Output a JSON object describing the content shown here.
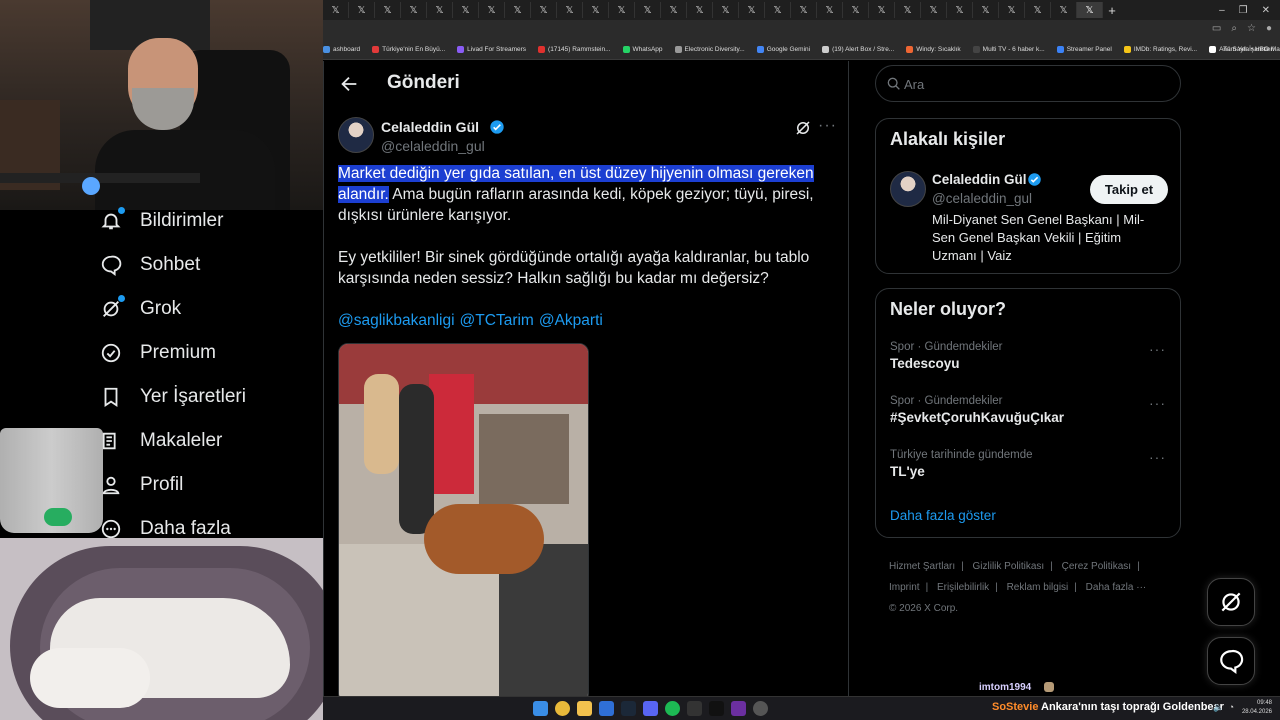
{
  "browser": {
    "tab_glyph": "𝕏",
    "tab_count": 30,
    "new_tab": "+",
    "bookmarks": [
      "ashboard",
      "Türkiye'nin En Büyü...",
      "Livad For Streamers",
      "(17145) Rammstein...",
      "WhatsApp",
      "Electronic Diversity...",
      "Google Gemini",
      "(19) Alert Box / Stre...",
      "Windy: Sıcaklık",
      "Multi TV - 6 haber k...",
      "Streamer Panel",
      "IMDb: Ratings, Revi...",
      "Ana Sayfa • HBO Max"
    ],
    "bookmarks_more": "»",
    "all_bookmarks": "Tüm Yer İşaretleri"
  },
  "nav": {
    "items": [
      {
        "label": "Bildirimler",
        "icon": "bell-icon",
        "badge": true
      },
      {
        "label": "Sohbet",
        "icon": "chat-bubble-icon",
        "badge": false
      },
      {
        "label": "Grok",
        "icon": "grok-icon",
        "badge": true
      },
      {
        "label": "Premium",
        "icon": "premium-badge-icon",
        "badge": false
      },
      {
        "label": "Yer İşaretleri",
        "icon": "bookmark-icon",
        "badge": false
      },
      {
        "label": "Makaleler",
        "icon": "article-icon",
        "badge": false
      },
      {
        "label": "Profil",
        "icon": "profile-icon",
        "badge": false
      },
      {
        "label": "Daha fazla",
        "icon": "more-circle-icon",
        "badge": false
      }
    ]
  },
  "main": {
    "title": "Gönderi",
    "author": {
      "name": "Celaleddin Gül",
      "handle": "@celaleddin_gul",
      "verified": true
    },
    "tweet": {
      "highlighted": "Market dediğin yer gıda satılan, en üst düzey hijyenin olması gereken alandır.",
      "rest": " Ama bugün rafların arasında kedi, köpek geziyor; tüyü, piresi, dışkısı ürünlere karışıyor.",
      "paragraph2": "Ey yetkililer! Bir sinek gördüğünde ortalığı ayağa kaldıranlar, bu tablo karşısında neden sessiz? Halkın sağlığı bu kadar mı değersiz?",
      "mentions": [
        "@saglikbakanligi",
        "@TCTarim",
        "@Akparti"
      ]
    }
  },
  "search": {
    "placeholder": "Ara"
  },
  "related": {
    "title": "Alakalı kişiler",
    "name": "Celaleddin Gül",
    "handle": "@celaleddin_gul",
    "follow_label": "Takip et",
    "bio": "Mil-Diyanet Sen Genel Başkanı | Mil-Sen Genel Başkan Vekili | Eğitim Uzmanı | Vaiz"
  },
  "trending": {
    "title": "Neler oluyor?",
    "items": [
      {
        "meta": "Spor · Gündemdekiler",
        "name": "Tedescoyu"
      },
      {
        "meta": "Spor · Gündemdekiler",
        "name": "#ŞevketÇoruhKavuğuÇıkar"
      },
      {
        "meta": "Türkiye tarihinde gündemde",
        "name": "TL'ye"
      }
    ],
    "show_more": "Daha fazla göster"
  },
  "footer": {
    "links": [
      "Hizmet Şartları",
      "Gizlilik Politikası",
      "Çerez Politikası",
      "Imprint",
      "Erişilebilirlik",
      "Reklam bilgisi",
      "Daha fazla ···"
    ],
    "copyright": "© 2026 X Corp."
  },
  "chat": {
    "user": "imtom1994"
  },
  "ticker": {
    "user": "SoStevie",
    "text": "Ankara'nın taşı toprağı Goldenbear"
  },
  "clock": {
    "time": "09:48",
    "date": "28.04.2026"
  },
  "colors": {
    "accent": "#1d9bf0",
    "highlight": "#1c3fd2",
    "background": "#000000",
    "border": "#2f3336"
  }
}
